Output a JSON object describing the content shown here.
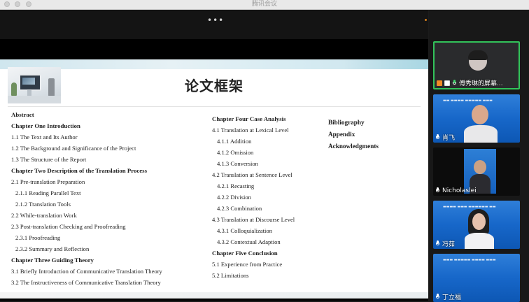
{
  "window": {
    "title": "腾讯会议"
  },
  "slide": {
    "title": "论文框架",
    "left_column": [
      {
        "text": "Abstract",
        "bold": true
      },
      {
        "text": "Chapter One Introduction",
        "bold": true
      },
      {
        "text": "1.1 The Text and Its Author",
        "bold": false
      },
      {
        "text": "1.2 The Background and Significance of the Project",
        "bold": false
      },
      {
        "text": "1.3 The Structure of the Report",
        "bold": false
      },
      {
        "text": "Chapter Two  Description of the Translation Process",
        "bold": true
      },
      {
        "text": "2.1 Pre-translation Preparation",
        "bold": false
      },
      {
        "text": "2.1.1 Reading Parallel Text",
        "bold": false,
        "indent": true
      },
      {
        "text": "2.1.2 Translation Tools",
        "bold": false,
        "indent": true
      },
      {
        "text": "2.2 While-translation Work",
        "bold": false
      },
      {
        "text": "2.3 Post-translation Checking and Proofreading",
        "bold": false
      },
      {
        "text": "2.3.1 Proofreading",
        "bold": false,
        "indent": true
      },
      {
        "text": "2.3.2 Summary and Reflection",
        "bold": false,
        "indent": true
      },
      {
        "text": "Chapter Three  Guiding Theory",
        "bold": true
      },
      {
        "text": "3.1 Briefly Introduction of Communicative Translation Theory",
        "bold": false
      },
      {
        "text": "3.2 The Instructiveness of Communicative Translation Theory",
        "bold": false
      }
    ],
    "middle_column": [
      {
        "text": "Chapter Four  Case Analysis",
        "bold": true
      },
      {
        "text": "4.1 Translation at Lexical Level",
        "bold": false
      },
      {
        "text": "4.1.1 Addition",
        "bold": false,
        "indent": true
      },
      {
        "text": "4.1.2 Omission",
        "bold": false,
        "indent": true
      },
      {
        "text": "4.1.3 Conversion",
        "bold": false,
        "indent": true
      },
      {
        "text": "4.2 Translation at Sentence Level",
        "bold": false
      },
      {
        "text": "4.2.1 Recasting",
        "bold": false,
        "indent": true
      },
      {
        "text": "4.2.2 Division",
        "bold": false,
        "indent": true
      },
      {
        "text": "4.2.3 Combination",
        "bold": false,
        "indent": true
      },
      {
        "text": "4.3 Translation at Discourse Level",
        "bold": false
      },
      {
        "text": "4.3.1 Colloquialization",
        "bold": false,
        "indent": true
      },
      {
        "text": "4.3.2 Contextual Adaption",
        "bold": false,
        "indent": true
      },
      {
        "text": "Chapter Five  Conclusion",
        "bold": true
      },
      {
        "text": "5.1 Experience from Practice",
        "bold": false
      },
      {
        "text": "5.2 Limitations",
        "bold": false
      }
    ],
    "right_column": [
      {
        "text": "Bibliography",
        "bold": true
      },
      {
        "text": "Appendix",
        "bold": true
      },
      {
        "text": "Acknowledgments",
        "bold": true
      }
    ]
  },
  "participants": [
    {
      "name": "傅秀琳的屏幕...",
      "sharing": true,
      "mic": "on",
      "active": true
    },
    {
      "name": "肖飞",
      "mic": "off"
    },
    {
      "name": "Nicholaslei",
      "mic": "off"
    },
    {
      "name": "冯茹",
      "mic": "off"
    },
    {
      "name": "丁立福",
      "mic": "off"
    }
  ],
  "colors": {
    "active_border": "#32c35a",
    "mic_on": "#3fd46b",
    "share_icon": "#f08a24",
    "banner_blue": "#1767c9",
    "toolbar_dot": "#d7801b"
  }
}
